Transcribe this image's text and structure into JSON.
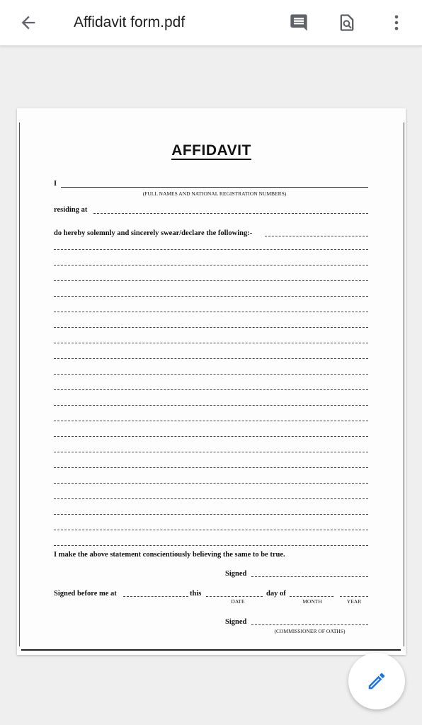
{
  "app_bar": {
    "title": "Affidavit form.pdf",
    "icons": {
      "back": "arrow-back-icon",
      "comment": "comment-icon",
      "search": "find-in-page-icon",
      "more": "more-vert-icon"
    }
  },
  "document": {
    "title": "AFFIDAVIT",
    "line_i": "I",
    "names_caption": "(FULL NAMES AND NATIONAL REGISTRATION NUMBERS)",
    "residing_label": "residing at",
    "swear_text": "do hereby solemnly and sincerely swear/declare the following:-",
    "statement_text": "I make the above statement conscientiously believing the same to be true.",
    "signed_label": "Signed",
    "signed_before_label": "Signed before me at",
    "this_label": "this",
    "date_caption": "DATE",
    "day_of_label": "day of",
    "month_caption": "MONTH",
    "year_caption": "YEAR",
    "signed_label_2": "Signed",
    "commissioner_caption": "(COMMISSIONER OF OATHS)"
  },
  "fab": {
    "icon": "edit-pencil-icon"
  },
  "colors": {
    "app_bar_bg": "#ffffff",
    "viewer_bg": "#efefef",
    "icon_gray": "#5f6368",
    "fab_pencil": "#1a73e8"
  }
}
